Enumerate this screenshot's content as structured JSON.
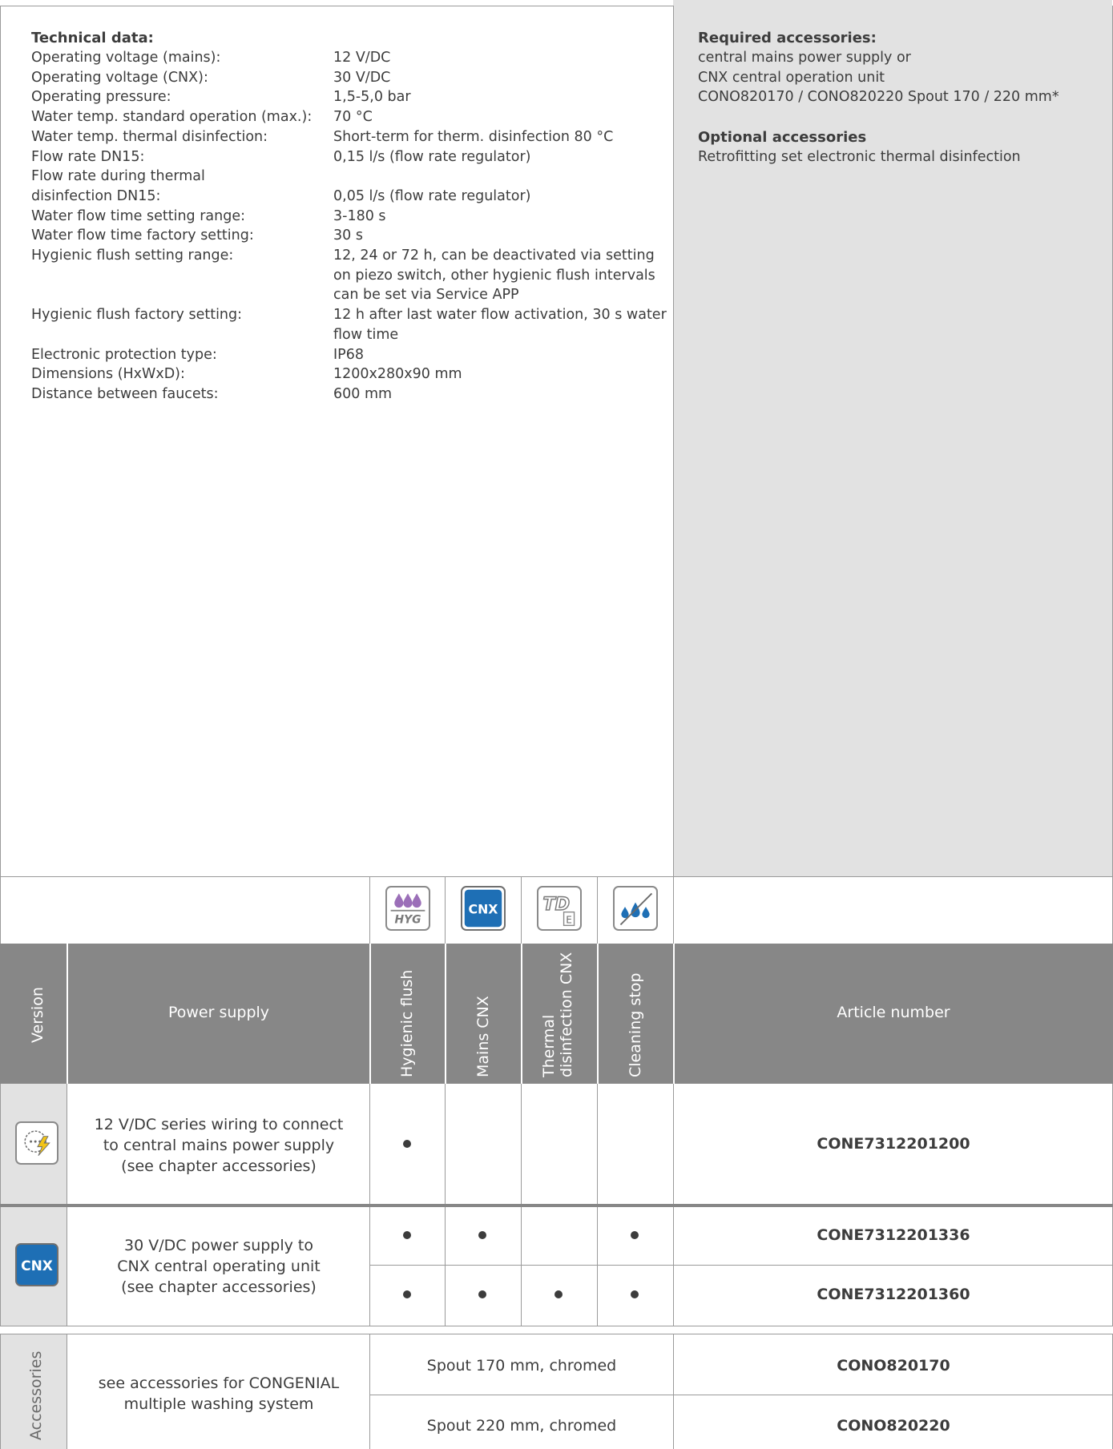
{
  "technical": {
    "heading": "Technical data:",
    "rows": [
      {
        "k": "Operating voltage (mains):",
        "v": "12 V/DC"
      },
      {
        "k": "Operating voltage (CNX):",
        "v": "30 V/DC"
      },
      {
        "k": "Operating pressure:",
        "v": "1,5-5,0 bar"
      },
      {
        "k": "Water temp. standard operation (max.):",
        "v": "70 °C"
      },
      {
        "k": "Water temp. thermal disinfection:",
        "v": "Short-term for therm. disinfection 80 °C"
      },
      {
        "k": "Flow rate DN15:",
        "v": "0,15 l/s (flow rate regulator)"
      },
      {
        "k": "Flow rate during thermal",
        "v": ""
      },
      {
        "k": "disinfection DN15:",
        "v": "0,05 l/s (flow rate regulator)"
      },
      {
        "k": "Water flow time setting range:",
        "v": "3-180 s"
      },
      {
        "k": "Water flow time factory setting:",
        "v": "30 s"
      },
      {
        "k": "Hygienic flush setting range:",
        "v": "12, 24 or 72 h, can be deactivated via setting on piezo switch, other hygienic flush intervals can be set via Service APP"
      },
      {
        "k": "Hygienic flush factory setting:",
        "v": "12 h after last water flow activation, 30 s water flow time"
      },
      {
        "k": "Electronic protection type:",
        "v": "IP68"
      },
      {
        "k": "Dimensions (HxWxD):",
        "v": "1200x280x90 mm"
      },
      {
        "k": "Distance between faucets:",
        "v": "600 mm"
      }
    ]
  },
  "accessories_info": {
    "required_heading": "Required accessories:",
    "required_lines": [
      "central mains power supply or",
      "CNX central operation unit",
      "CONO820170 / CONO820220 Spout 170 / 220 mm*"
    ],
    "optional_heading": "Optional accessories",
    "optional_lines": [
      "Retrofitting set electronic thermal disinfection"
    ]
  },
  "icons": {
    "hyg_text": "HYG",
    "cnx_text": "CNX",
    "td_text": "TD",
    "td_sub": "E",
    "cnx_color": "#1e6fb5",
    "hyg_color": "#9b6fb8",
    "drop_color": "#1e6fb5"
  },
  "table": {
    "header": {
      "version": "Version",
      "power_supply": "Power supply",
      "hygienic_flush": "Hygienic flush",
      "mains_cnx": "Mains CNX",
      "thermal_1": "Thermal",
      "thermal_2": "disinfection CNX",
      "cleaning_stop": "Cleaning stop",
      "article_number": "Article number"
    },
    "rows": [
      {
        "icon": "mains-power-icon",
        "power_supply": [
          "12 V/DC series wiring to connect",
          "to central mains power supply",
          "(see chapter accessories)"
        ],
        "hygienic_flush": true,
        "mains_cnx": false,
        "thermal": false,
        "cleaning_stop": false,
        "article": "CONE7312201200"
      },
      {
        "icon": "cnx-icon",
        "icon_text": "CNX",
        "power_supply": [
          "30 V/DC power supply to",
          "CNX central operating unit",
          "(see chapter accessories)"
        ],
        "variants": [
          {
            "hygienic_flush": true,
            "mains_cnx": true,
            "thermal": false,
            "cleaning_stop": true,
            "article": "CONE7312201336"
          },
          {
            "hygienic_flush": true,
            "mains_cnx": true,
            "thermal": true,
            "cleaning_stop": true,
            "article": "CONE7312201360"
          }
        ]
      }
    ]
  },
  "accessories_table": {
    "label": "Accessories",
    "description": [
      "see accessories for CONGENIAL",
      "multiple washing system"
    ],
    "items": [
      {
        "name": "Spout 170 mm, chromed",
        "article": "CONO820170"
      },
      {
        "name": "Spout 220 mm, chromed",
        "article": "CONO820220"
      }
    ]
  }
}
